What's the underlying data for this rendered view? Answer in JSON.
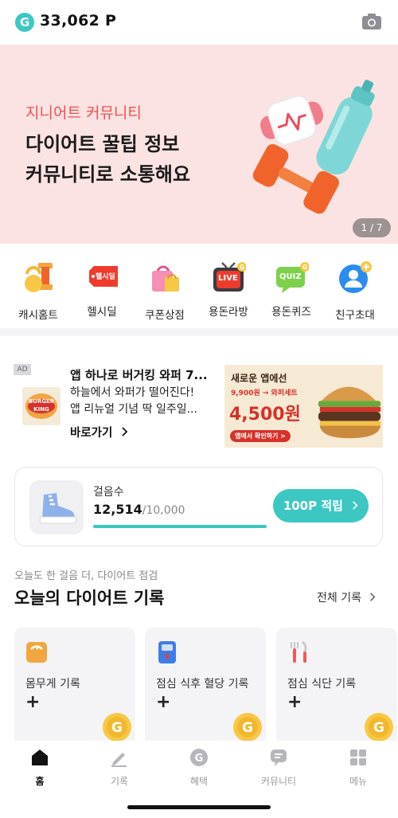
{
  "header": {
    "points": "33,062 P",
    "logo_letter": "G",
    "camera_icon": "camera-icon"
  },
  "banner": {
    "eyebrow": "지니어트 커뮤니티",
    "title_line1": "다이어트 꿀팁 정보",
    "title_line2": "커뮤니티로 소통해요",
    "page_indicator": "1 / 7"
  },
  "shortcuts": [
    {
      "label": "캐시홈트",
      "icon": "kettlebell-icon"
    },
    {
      "label": "헬시딜",
      "icon": "healthy-deal-tag-icon",
      "badge": "헬시딜"
    },
    {
      "label": "쿠폰상점",
      "icon": "shopping-bag-icon"
    },
    {
      "label": "용돈라방",
      "icon": "live-tv-icon",
      "badge": "LIVE"
    },
    {
      "label": "용돈퀴즈",
      "icon": "quiz-bubble-icon",
      "badge": "QUIZ"
    },
    {
      "label": "친구초대",
      "icon": "add-friend-icon"
    }
  ],
  "ad": {
    "tag": "AD",
    "title": "앱 하나로 버거킹 와퍼 7...",
    "desc_line1": "하늘에서 와퍼가 떨어진다!",
    "desc_line2": "앱 리뉴얼 기념 딱 일주일...",
    "link": "바로가기",
    "logo_line1": "BURGER",
    "logo_line2": "KING",
    "image_line1": "새로운 앱에선",
    "image_line2": "9,900원 → 와퍼세트",
    "image_price": "4,500원",
    "image_button": "앱에서 확인하기 >"
  },
  "steps": {
    "label": "걸음수",
    "count": "12,514",
    "goal": "/10,000",
    "progress": 1.0,
    "button": "100P 적립"
  },
  "diet": {
    "subtitle": "오늘도 한 걸음 더, 다이어트 점검",
    "title": "오늘의 다이어트 기록",
    "view_all": "전체 기록",
    "cards": [
      {
        "label": "몸무게 기록",
        "icon": "scale-icon",
        "plus": "+"
      },
      {
        "label": "점심 식후 혈당 기록",
        "icon": "glucose-meter-icon",
        "plus": "+"
      },
      {
        "label": "점심 식단 기록",
        "icon": "fork-knife-icon",
        "plus": "+"
      }
    ]
  },
  "nav": [
    {
      "label": "홈",
      "icon": "home-icon",
      "active": true
    },
    {
      "label": "기록",
      "icon": "pencil-icon"
    },
    {
      "label": "혜택",
      "icon": "g-coin-icon"
    },
    {
      "label": "커뮤니티",
      "icon": "chat-bubble-icon"
    },
    {
      "label": "메뉴",
      "icon": "menu-grid-icon"
    }
  ],
  "colors": {
    "accent": "#3dc7c2",
    "banner_bg": "#fbe3e3",
    "eyebrow": "#f0504d"
  }
}
